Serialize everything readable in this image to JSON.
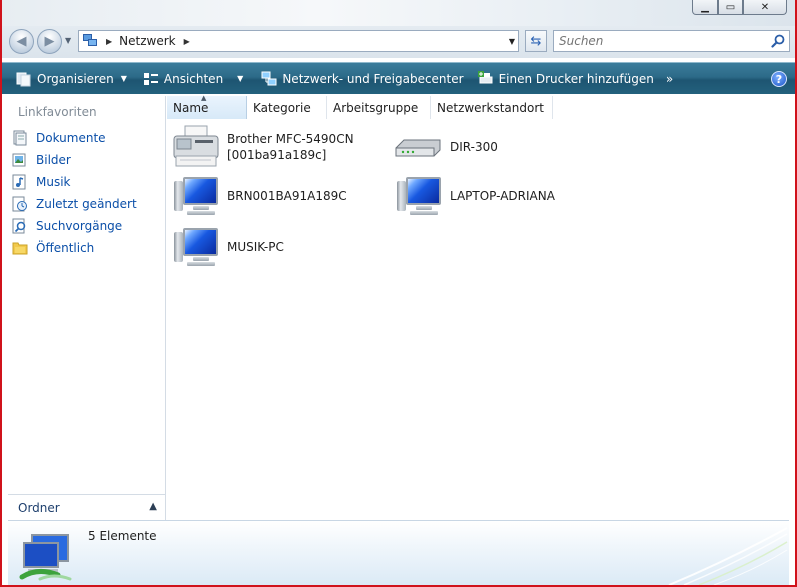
{
  "window": {
    "caption_buttons": [
      "minimize-icon",
      "maximize-icon",
      "close-icon"
    ]
  },
  "address": {
    "path": "Netzwerk",
    "search_placeholder": "Suchen",
    "icons": [
      "back-icon",
      "forward-icon",
      "network-icon",
      "refresh-icon",
      "search-icon"
    ]
  },
  "toolbar": {
    "items": [
      {
        "label": "Organisieren",
        "icon": "organize-icon",
        "dropdown": true
      },
      {
        "label": "Ansichten",
        "icon": "views-icon",
        "dropdown": true
      },
      {
        "label": "Netzwerk- und Freigabecenter",
        "icon": "network-center-icon",
        "dropdown": false
      },
      {
        "label": "Einen Drucker hinzufügen",
        "icon": "add-printer-icon",
        "dropdown": false
      }
    ],
    "more": "»",
    "help": "?"
  },
  "navpane": {
    "title": "Linkfavoriten",
    "items": [
      {
        "label": "Dokumente",
        "icon": "documents-icon"
      },
      {
        "label": "Bilder",
        "icon": "pictures-icon"
      },
      {
        "label": "Musik",
        "icon": "music-icon"
      },
      {
        "label": "Zuletzt geändert",
        "icon": "recent-icon"
      },
      {
        "label": "Suchvorgänge",
        "icon": "searches-icon"
      },
      {
        "label": "Öffentlich",
        "icon": "public-folder-icon"
      }
    ],
    "folders_label": "Ordner"
  },
  "columns": [
    "Name",
    "Kategorie",
    "Arbeitsgruppe",
    "Netzwerkstandort"
  ],
  "items": [
    {
      "name": "Brother MFC-5490CN",
      "sub": "[001ba91a189c]",
      "icon": "printer-icon"
    },
    {
      "name": "DIR-300",
      "sub": "",
      "icon": "router-icon"
    },
    {
      "name": "BRN001BA91A189C",
      "sub": "",
      "icon": "computer-icon"
    },
    {
      "name": "LAPTOP-ADRIANA",
      "sub": "",
      "icon": "computer-icon"
    },
    {
      "name": "MUSIK-PC",
      "sub": "",
      "icon": "computer-icon"
    }
  ],
  "details": {
    "count": "5 Elemente",
    "icon": "network-computers-icon"
  },
  "colors": {
    "toolbar": "#2c6a88",
    "link": "#0b4fa8",
    "frame": "#d0121b"
  }
}
